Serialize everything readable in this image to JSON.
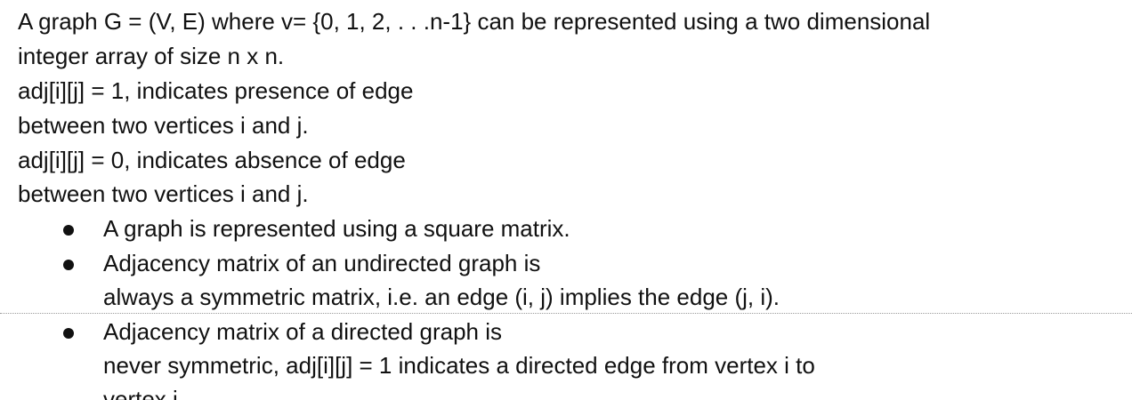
{
  "document": {
    "paragraph_lines": [
      "A graph G = (V, E) where v= {0, 1, 2, . . .n-1} can be represented using a two dimensional",
      "integer array of size n x n.",
      "adj[i][j] = 1, indicates presence of edge",
      "between two vertices i and j.",
      "adj[i][j] = 0, indicates absence of edge",
      "between two vertices i and j."
    ],
    "bullets": [
      {
        "lines": [
          "A graph is represented using a square matrix."
        ]
      },
      {
        "lines": [
          "Adjacency matrix of an undirected graph is",
          "always a symmetric matrix, i.e. an edge (i, j) implies the edge (j, i)."
        ]
      },
      {
        "lines": [
          "Adjacency matrix of a directed graph is",
          "never symmetric, adj[i][j] = 1 indicates a directed edge from vertex i to",
          "vertex j."
        ]
      }
    ]
  }
}
